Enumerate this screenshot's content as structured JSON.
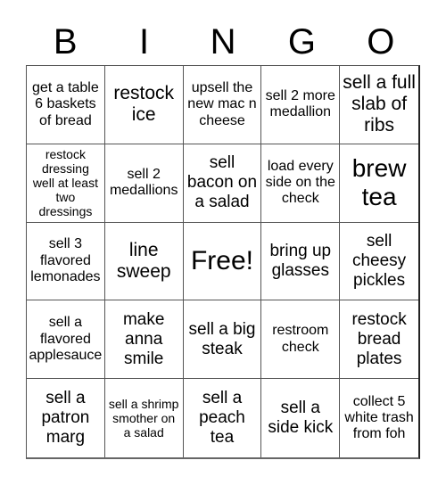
{
  "header": {
    "letters": [
      "B",
      "I",
      "N",
      "G",
      "O"
    ]
  },
  "cells": [
    "get a table 6 baskets of bread",
    "restock ice",
    "upsell the new mac n cheese",
    "sell 2 more medallion",
    "sell a full slab of ribs",
    "restock dressing well at least two dressings",
    "sell 2 medallions",
    "sell bacon on a salad",
    "load every side on the check",
    "brew tea",
    "sell 3 flavored lemonades",
    "line sweep",
    "Free!",
    "bring up glasses",
    "sell cheesy pickles",
    "sell a flavored applesauce",
    "make anna smile",
    "sell a big steak",
    "restroom check",
    "restock bread plates",
    "sell a patron marg",
    "sell a shrimp smother on a salad",
    "sell a peach tea",
    "sell a side kick",
    "collect 5 white trash from foh"
  ]
}
